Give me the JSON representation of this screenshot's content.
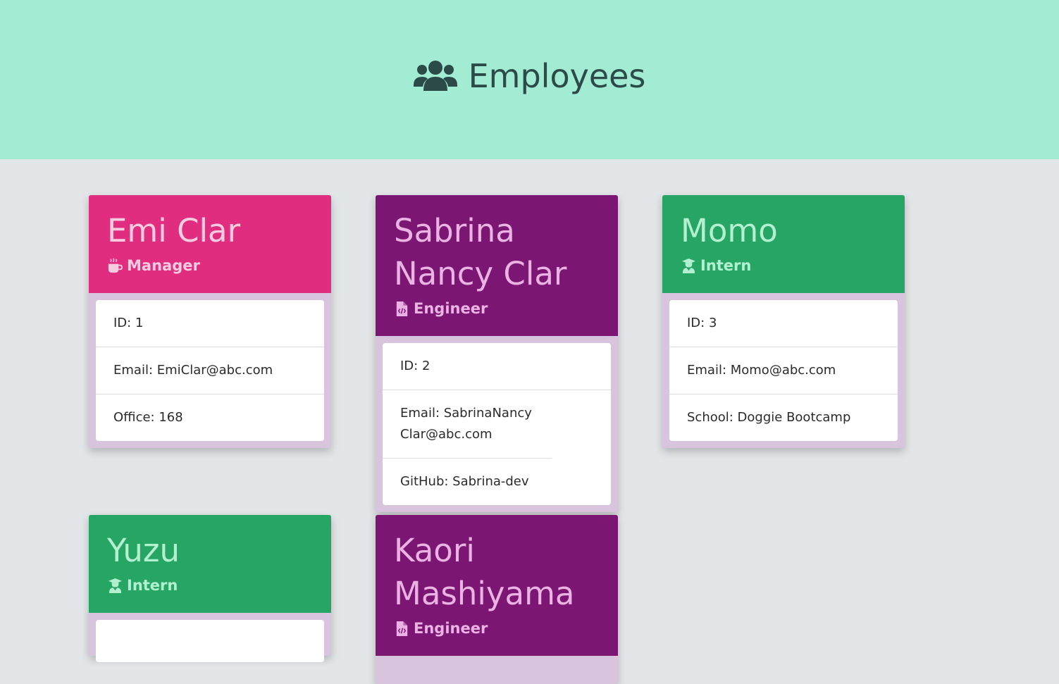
{
  "header": {
    "title": "Employees",
    "icon": "users-icon",
    "bg": "#a2ecd4"
  },
  "employees": [
    {
      "name": "Emi Clar",
      "role": "Manager",
      "role_icon": "coffee-icon",
      "details": [
        "ID: 1",
        "Email: EmiClar@abc.com",
        "Office: 168"
      ]
    },
    {
      "name": "Sabrina Nancy Clar",
      "role": "Engineer",
      "role_icon": "file-code-icon",
      "details": [
        "ID: 2",
        "Email: SabrinaNancyClar@abc.com",
        "GitHub: Sabrina-dev"
      ]
    },
    {
      "name": "Momo",
      "role": "Intern",
      "role_icon": "user-graduate-icon",
      "details": [
        "ID: 3",
        "Email: Momo@abc.com",
        "School: Doggie Bootcamp"
      ]
    },
    {
      "name": "Yuzu",
      "role": "Intern",
      "role_icon": "user-graduate-icon",
      "details": []
    },
    {
      "name": "Kaori Mashiyama",
      "role": "Engineer",
      "role_icon": "file-code-icon",
      "details": []
    }
  ],
  "colors": {
    "manager": "#e02d80",
    "engineer": "#7b1673",
    "intern": "#26a564",
    "page_bg": "#e3e6e8"
  }
}
